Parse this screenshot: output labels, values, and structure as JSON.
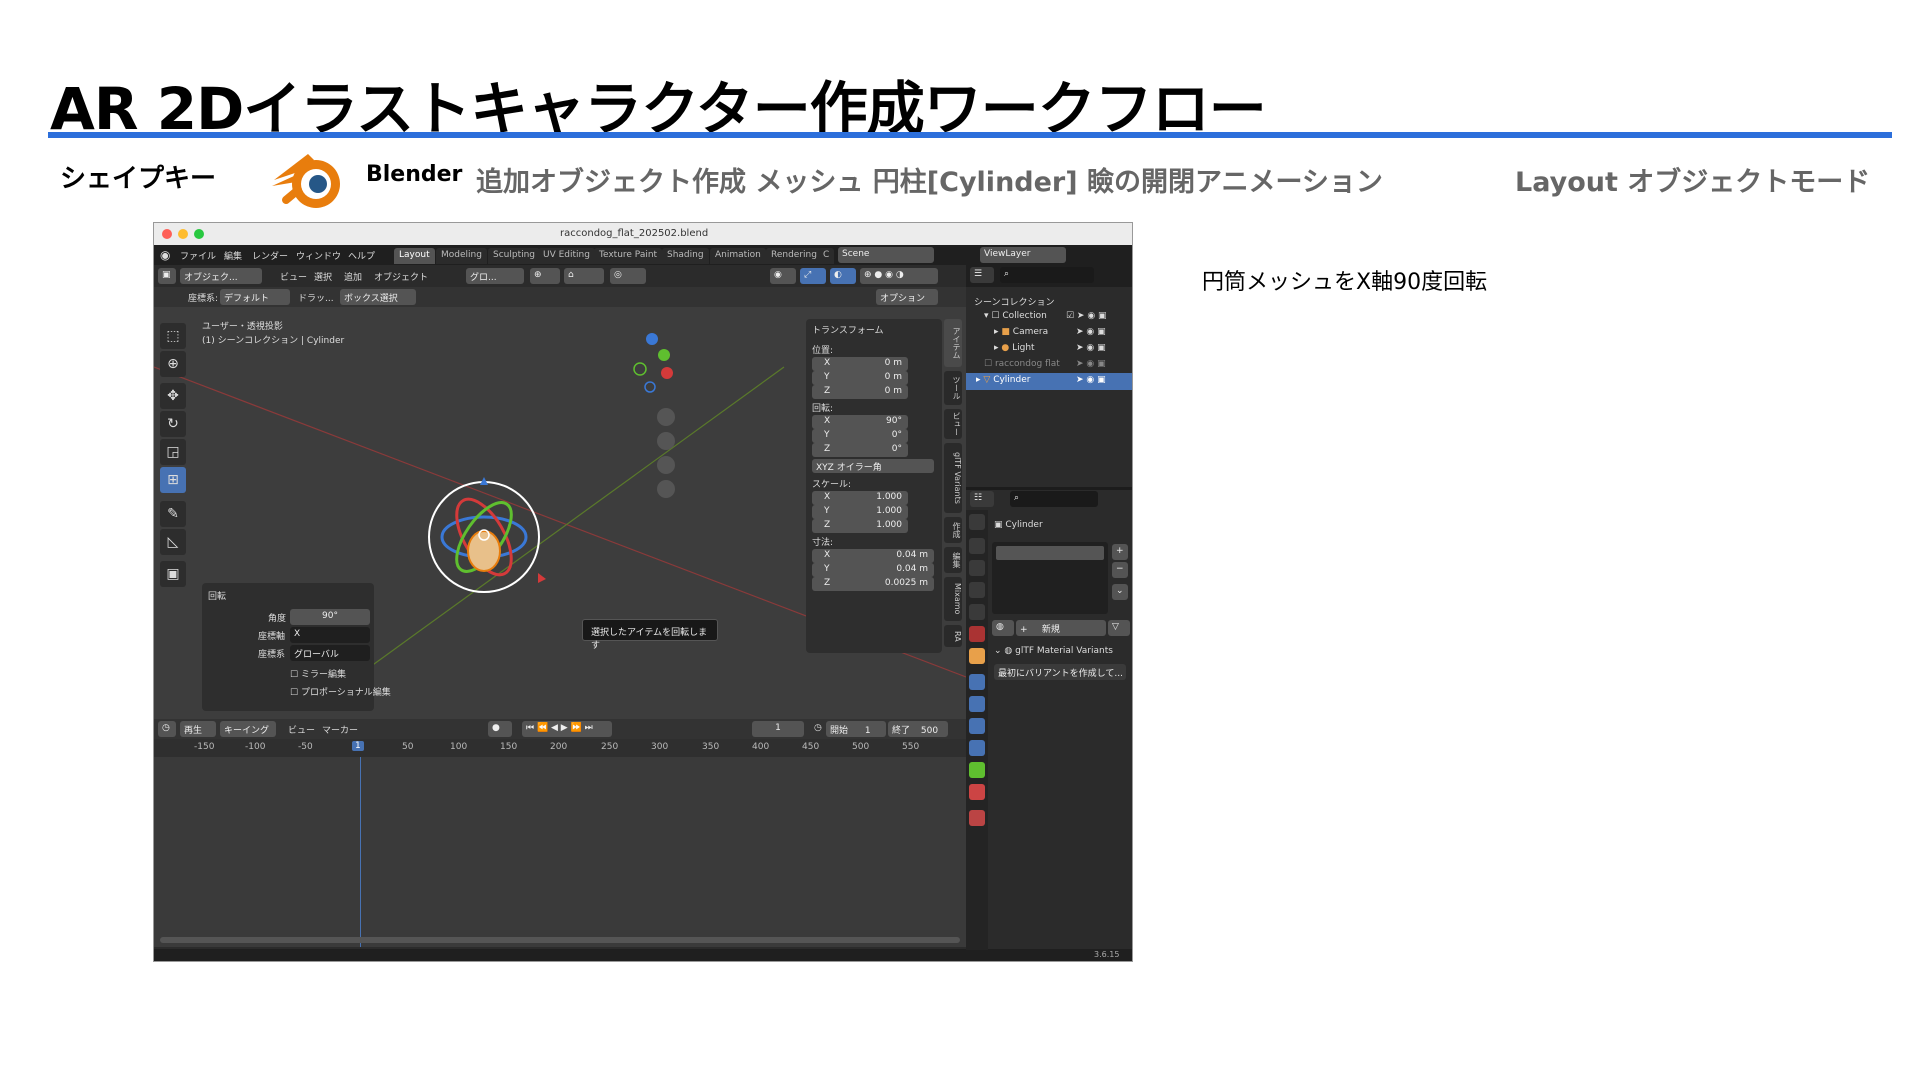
{
  "slide": {
    "title": "AR 2Dイラストキャラクター作成ワークフロー",
    "sub_topic": "シェイプキー",
    "app_name": "Blender",
    "operation": "追加オブジェクト作成 メッシュ 円柱[Cylinder] 瞼の開閉アニメーション",
    "mode": "Layout オブジェクトモード",
    "note": "円筒メッシュをX軸90度回転",
    "accent_color": "#2c6fdb"
  },
  "window": {
    "title": "raccondog_flat_202502.blend",
    "menus": [
      "ファイル",
      "編集",
      "レンダー",
      "ウィンドウ",
      "ヘルプ"
    ],
    "workspace_tabs": [
      "Layout",
      "Modeling",
      "Sculpting",
      "UV Editing",
      "Texture Paint",
      "Shading",
      "Animation",
      "Rendering",
      "C"
    ],
    "active_tab": "Layout",
    "scene": "Scene",
    "view_layer": "ViewLayer",
    "version": "3.6.15"
  },
  "viewport": {
    "mode_select": "オブジェク...",
    "header_menus": [
      "ビュー",
      "選択",
      "追加",
      "オブジェクト"
    ],
    "transform_orient": "グロ...",
    "coord_label": "座標系:",
    "coord_value": "デフォルト",
    "drag_label": "ドラッ...",
    "drag_value": "ボックス選択",
    "options": "オプション",
    "view_name": "ユーザー・透視投影",
    "collection_path": "(1) シーンコレクション | Cylinder",
    "tooltip": "選択したアイテムを回転します"
  },
  "transform_panel": {
    "header": "トランスフォーム",
    "location_label": "位置:",
    "location": [
      {
        "k": "X",
        "v": "0 m"
      },
      {
        "k": "Y",
        "v": "0 m"
      },
      {
        "k": "Z",
        "v": "0 m"
      }
    ],
    "rotation_label": "回転:",
    "rotation": [
      {
        "k": "X",
        "v": "90°"
      },
      {
        "k": "Y",
        "v": "0°"
      },
      {
        "k": "Z",
        "v": "0°"
      }
    ],
    "rotation_mode": "XYZ オイラー角",
    "scale_label": "スケール:",
    "scale": [
      {
        "k": "X",
        "v": "1.000"
      },
      {
        "k": "Y",
        "v": "1.000"
      },
      {
        "k": "Z",
        "v": "1.000"
      }
    ],
    "dims_label": "寸法:",
    "dims": [
      {
        "k": "X",
        "v": "0.04 m"
      },
      {
        "k": "Y",
        "v": "0.04 m"
      },
      {
        "k": "Z",
        "v": "0.0025 m"
      }
    ]
  },
  "side_tabs": [
    "アイテム",
    "ツール",
    "ビュー",
    "glTF Variants",
    "作成",
    "編集",
    "Mixamo",
    "RA"
  ],
  "redo_panel": {
    "header": "回転",
    "angle_label": "角度",
    "angle": "90°",
    "axis_label": "座標軸",
    "axis": "X",
    "orient_label": "座標系",
    "orient": "グローバル",
    "mirror": "ミラー編集",
    "proportional": "プロポーショナル編集"
  },
  "timeline": {
    "menus": [
      "再生",
      "キーイング",
      "ビュー",
      "マーカー"
    ],
    "current_frame": "1",
    "start_label": "開始",
    "start": "1",
    "end_label": "終了",
    "end": "500",
    "ruler": [
      "-150",
      "-100",
      "-50",
      "1",
      "50",
      "100",
      "150",
      "200",
      "250",
      "300",
      "350",
      "400",
      "450",
      "500",
      "550"
    ]
  },
  "outliner": {
    "root": "シーンコレクション",
    "items": [
      {
        "name": "Collection",
        "indent": 1
      },
      {
        "name": "Camera",
        "indent": 2
      },
      {
        "name": "Light",
        "indent": 2
      },
      {
        "name": "raccondog flat",
        "indent": 1
      },
      {
        "name": "Cylinder",
        "indent": 1
      }
    ]
  },
  "properties": {
    "object_name": "Cylinder",
    "new_label": "新規",
    "variants_header": "glTF Material Variants",
    "variants_button": "最初にバリアントを作成して..."
  }
}
